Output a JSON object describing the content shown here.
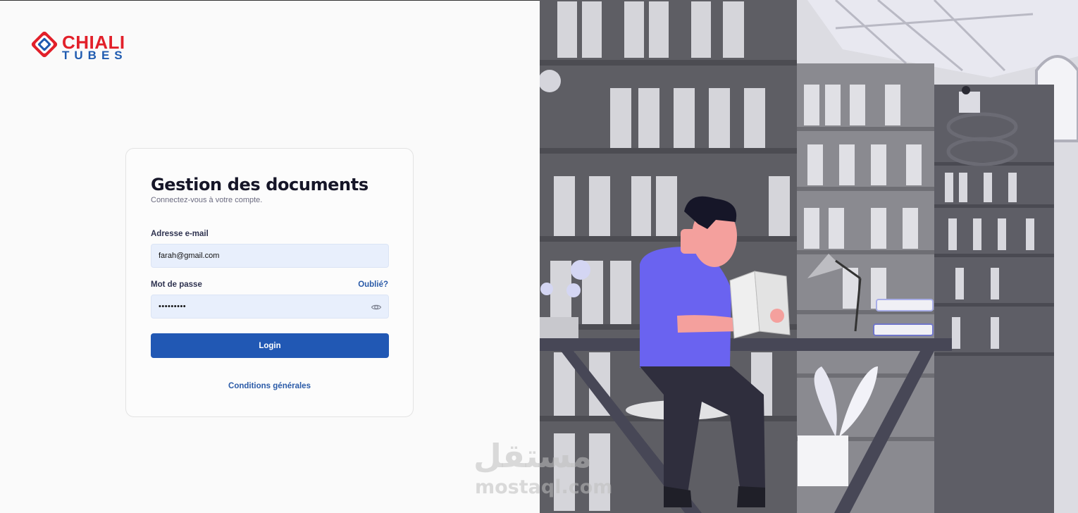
{
  "brand": {
    "line1": "CHIALI",
    "line2": "TUBES",
    "colors": {
      "red": "#e2202a",
      "blue": "#1f5bb0"
    }
  },
  "login": {
    "title": "Gestion des documents",
    "subtitle": "Connectez-vous à votre compte.",
    "email_label": "Adresse e-mail",
    "email_value": "farah@gmail.com",
    "password_label": "Mot de passe",
    "forgot_label": "Oublié?",
    "password_value": "secret123",
    "submit_label": "Login",
    "terms_label": "Conditions générales"
  },
  "icons": {
    "logo": "chiali-logo-icon",
    "password_toggle": "eye-icon"
  },
  "watermark": {
    "arabic": "مستقل",
    "latin": "mostaql.com"
  },
  "theme": {
    "primary": "#2158b4",
    "link": "#2b5ba8",
    "input_bg": "#e8effc"
  }
}
